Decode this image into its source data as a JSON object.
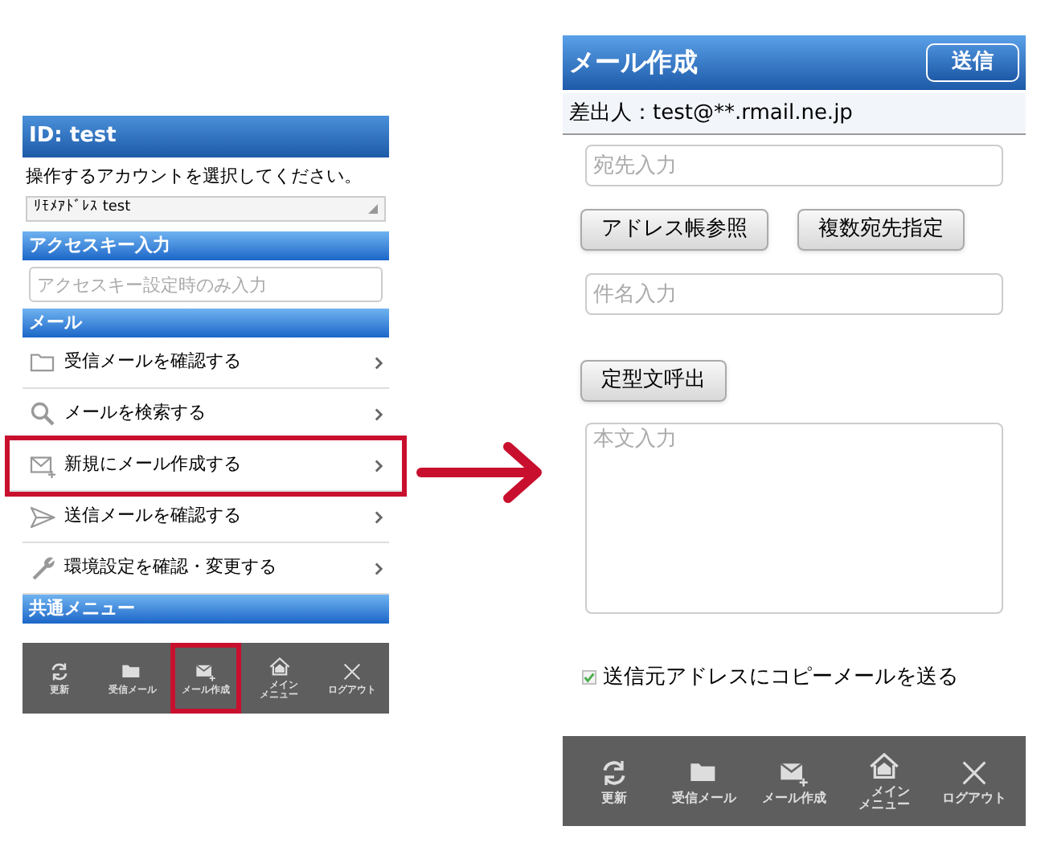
{
  "menu_screen": {
    "title": "ID: test",
    "prompt": "操作するアカウントを選択してください。",
    "account_select": {
      "value": "ﾘﾓﾒｱﾄﾞﾚｽ test"
    },
    "access_key_header": "アクセスキー入力",
    "access_key_field": {
      "placeholder": "アクセスキー設定時のみ入力"
    },
    "mail_header": "メール",
    "menu_items": [
      {
        "label": "受信メールを確認する",
        "kind": "folder",
        "highlighted": false
      },
      {
        "label": "メールを検索する",
        "kind": "search",
        "highlighted": false
      },
      {
        "label": "新規にメール作成する",
        "kind": "mail",
        "highlighted": true
      },
      {
        "label": "送信メールを確認する",
        "kind": "send",
        "highlighted": false
      },
      {
        "label": "環境設定を確認・変更する",
        "kind": "wrench",
        "highlighted": false
      }
    ],
    "common_header": "共通メニュー",
    "toolbar": [
      {
        "label": "更新",
        "kind": "refresh",
        "highlighted": false
      },
      {
        "label": "受信メール",
        "kind": "folder",
        "highlighted": false
      },
      {
        "label": "メール作成",
        "kind": "mail",
        "highlighted": true
      },
      {
        "label": "メインメニュー",
        "kind": "home",
        "highlighted": false
      },
      {
        "label": "ログアウト",
        "kind": "close",
        "highlighted": false
      }
    ]
  },
  "compose_screen": {
    "title": "メール作成",
    "send_button": "送信",
    "sender": "差出人：test@**.rmail.ne.jp",
    "to_field": {
      "placeholder": "宛先入力"
    },
    "buttons": [
      "アドレス帳参照",
      "複数宛先指定"
    ],
    "subject_field": {
      "placeholder": "件名入力"
    },
    "template_button": "定型文呼出",
    "body_field": {
      "placeholder": "本文入力"
    },
    "copy_checkbox": {
      "label": "送信元アドレスにコピーメールを送る",
      "checked": true
    },
    "toolbar": [
      {
        "label": "更新",
        "kind": "refresh",
        "highlighted": false
      },
      {
        "label": "受信メール",
        "kind": "folder",
        "highlighted": false
      },
      {
        "label": "メール作成",
        "kind": "mail",
        "highlighted": false
      },
      {
        "label": "メインメニュー",
        "kind": "home",
        "highlighted": false
      },
      {
        "label": "ログアウト",
        "kind": "close",
        "highlighted": false
      }
    ]
  }
}
